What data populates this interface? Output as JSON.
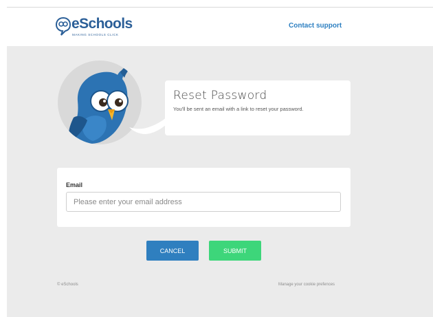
{
  "header": {
    "logo": {
      "name": "eSchools",
      "tagline": "MAKING SCHOOLS CLICK"
    },
    "contact_link": "Contact support"
  },
  "mascot": {
    "icon": "bird-mascot-icon"
  },
  "bubble": {
    "title": "Reset Password",
    "text": "You'll be sent an email with a link to reset your password."
  },
  "form": {
    "email_label": "Email",
    "email_value": "",
    "email_placeholder": "Please enter your email address"
  },
  "buttons": {
    "cancel": "CANCEL",
    "submit": "SUBMIT"
  },
  "footer": {
    "copyright": "© eSchools",
    "cookie_link": "Manage your cookie prefences"
  },
  "colors": {
    "brand": "#2b5f98",
    "link": "#2c7fc1",
    "cancel_button": "#2f7fbf",
    "submit_button": "#3dd67a",
    "page_background": "#ebebeb"
  }
}
